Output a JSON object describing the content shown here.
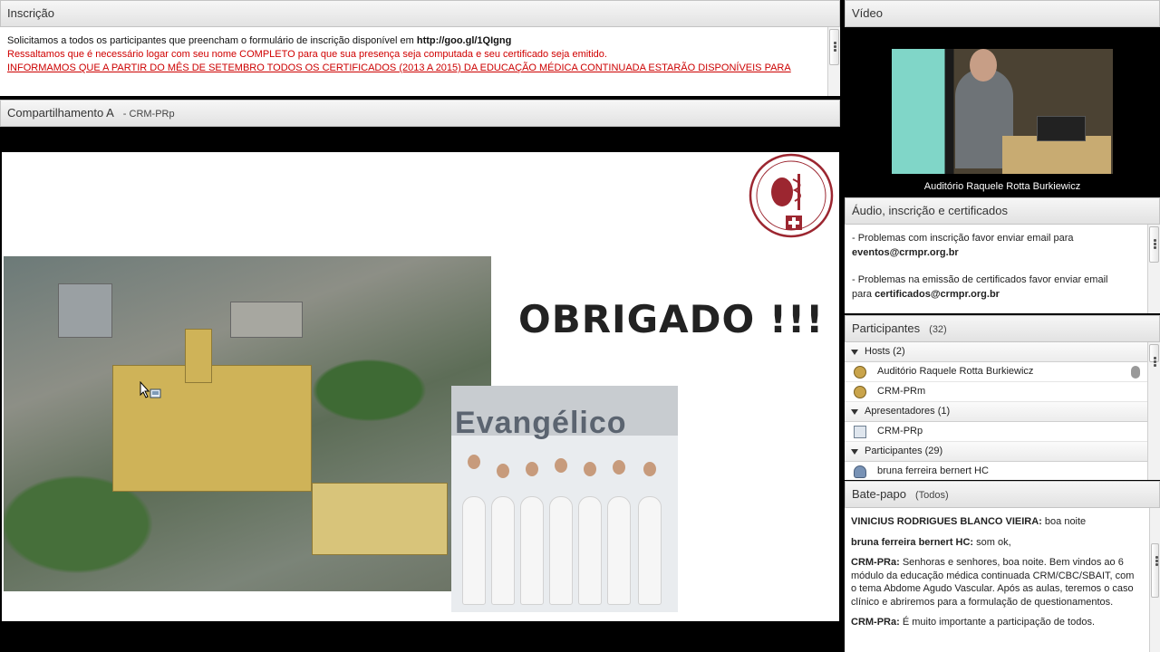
{
  "inscricao": {
    "title": "Inscrição",
    "line1_prefix": "Solicitamos a todos os participantes que preencham o formulário de inscrição disponível em ",
    "line1_link": "http://goo.gl/1QIgng",
    "line2": "Ressaltamos que é necessário logar com seu nome COMPLETO para que sua presença seja computada e seu certificado seja emitido.",
    "line3": "INFORMAMOS QUE A PARTIR DO MÊS DE SETEMBRO TODOS OS CERTIFICADOS (2013 A 2015) DA EDUCAÇÃO MÉDICA CONTINUADA ESTARÃO DISPONÍVEIS PARA"
  },
  "share": {
    "title": "Compartilhamento A",
    "presenter": "- CRM-PRp",
    "slide_title": "OBRIGADO !!!",
    "team_sign": "Evangélico"
  },
  "video": {
    "title": "Vídeo",
    "caption": "Auditório Raquele Rotta Burkiewicz"
  },
  "audio": {
    "title": "Áudio, inscrição e certificados",
    "line1": "- Problemas com inscrição favor enviar email para",
    "email1": "eventos@crmpr.org.br",
    "line2": "- Problemas na emissão de certificados favor enviar email",
    "line3_prefix": "para ",
    "email2": "certificados@crmpr.org.br"
  },
  "participants": {
    "title": "Participantes",
    "count": "(32)",
    "groups": [
      {
        "label": "Hosts (2)",
        "members": [
          "Auditório Raquele Rotta Burkiewicz",
          "CRM-PRm"
        ]
      },
      {
        "label": "Apresentadores (1)",
        "members": [
          "CRM-PRp"
        ]
      },
      {
        "label": "Participantes (29)",
        "members": [
          "bruna ferreira bernert HC"
        ]
      }
    ]
  },
  "chat": {
    "title": "Bate-papo",
    "scope": "(Todos)",
    "messages": [
      {
        "author": "VINICIUS RODRIGUES BLANCO VIEIRA:",
        "text": " boa noite"
      },
      {
        "author": "bruna ferreira bernert HC:",
        "text": " som ok,"
      },
      {
        "author": "CRM-PRa:",
        "text": " Senhoras e senhores, boa noite. Bem vindos ao 6 módulo da educação médica continuada CRM/CBC/SBAIT, com o tema Abdome Agudo Vascular. Após as aulas, teremos o caso clínico e abriremos para a formulação de questionamentos."
      },
      {
        "author": "CRM-PRa:",
        "text": " É muito importante a participação de todos."
      }
    ]
  },
  "colors": {
    "red_text": "#d00000",
    "header_bg": "#e6e6e6",
    "background": "#000000"
  }
}
